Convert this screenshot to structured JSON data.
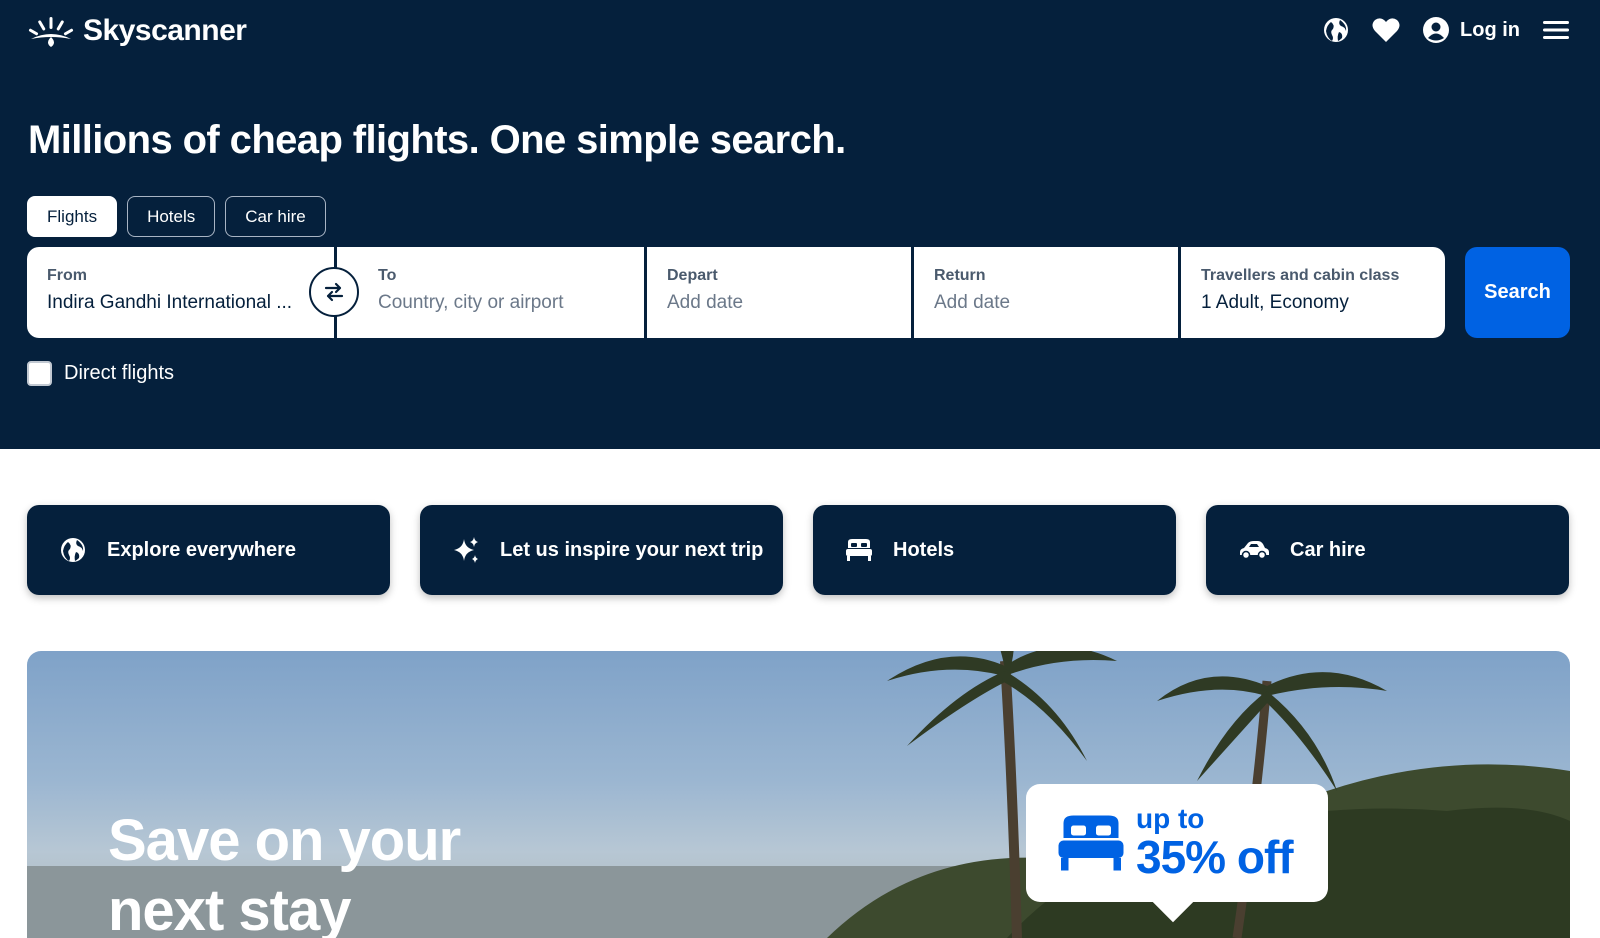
{
  "brand": {
    "name": "Skyscanner"
  },
  "nav": {
    "login_label": "Log in"
  },
  "hero": {
    "title": "Millions of cheap flights. One simple search."
  },
  "tabs": [
    {
      "label": "Flights",
      "active": true
    },
    {
      "label": "Hotels",
      "active": false
    },
    {
      "label": "Car hire",
      "active": false
    }
  ],
  "search": {
    "from": {
      "label": "From",
      "value": "Indira Gandhi International  ..."
    },
    "to": {
      "label": "To",
      "placeholder": "Country, city or airport"
    },
    "depart": {
      "label": "Depart",
      "placeholder": "Add date"
    },
    "return": {
      "label": "Return",
      "placeholder": "Add date"
    },
    "travellers": {
      "label": "Travellers and cabin class",
      "value": "1 Adult, Economy"
    },
    "button_label": "Search",
    "direct_label": "Direct flights",
    "direct_checked": false
  },
  "quick_links": [
    {
      "label": "Explore everywhere",
      "icon": "globe-icon"
    },
    {
      "label": "Let us inspire your next trip",
      "icon": "sparkle-icon"
    },
    {
      "label": "Hotels",
      "icon": "hotel-bed-icon"
    },
    {
      "label": "Car hire",
      "icon": "car-icon"
    }
  ],
  "banner": {
    "title": "Save on your next stay",
    "promo_small": "up to",
    "promo_big": "35% off"
  },
  "colors": {
    "hero_bg": "#05203c",
    "accent": "#0062e3",
    "white": "#ffffff"
  }
}
